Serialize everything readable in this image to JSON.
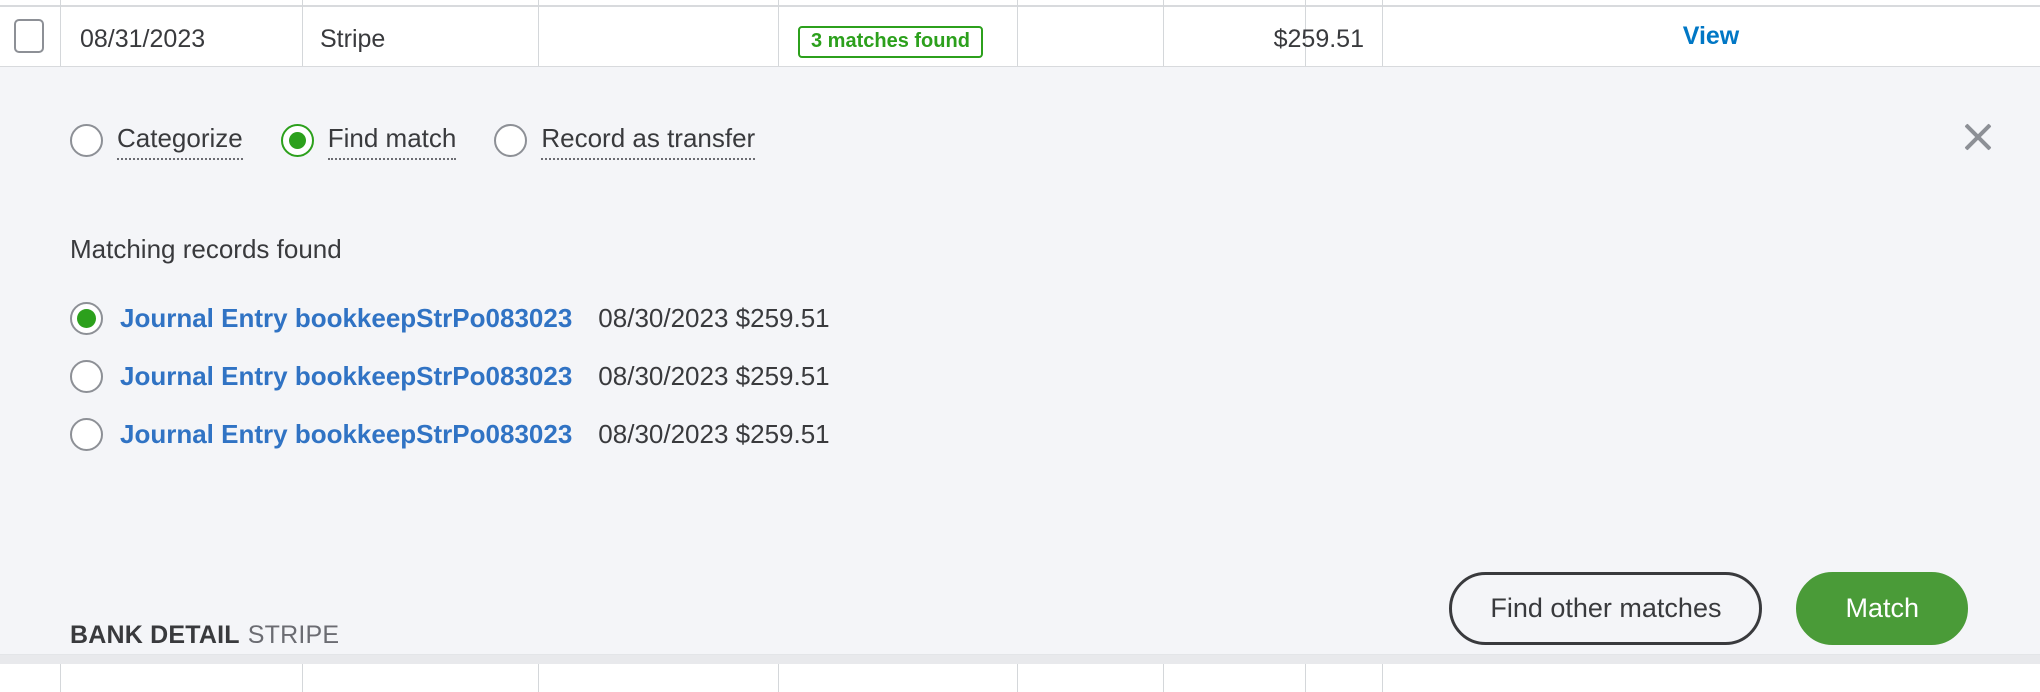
{
  "transaction_row": {
    "checkbox_checked": false,
    "date": "08/31/2023",
    "payee": "Stripe",
    "category": "",
    "badge": "3 matches found",
    "badge_color": "#2ca01c",
    "spent": "",
    "amount": "$259.51",
    "action": "View",
    "action_color": "#0077c5"
  },
  "panel": {
    "modes": [
      {
        "label": "Categorize",
        "selected": false
      },
      {
        "label": "Find match",
        "selected": true
      },
      {
        "label": "Record as transfer",
        "selected": false
      }
    ],
    "close_icon": "close-icon",
    "heading": "Matching records found",
    "records": [
      {
        "selected": true,
        "link": "Journal Entry bookkeepStrPo083023",
        "meta": "08/30/2023 $259.51"
      },
      {
        "selected": false,
        "link": "Journal Entry bookkeepStrPo083023",
        "meta": "08/30/2023 $259.51"
      },
      {
        "selected": false,
        "link": "Journal Entry bookkeepStrPo083023",
        "meta": "08/30/2023 $259.51"
      }
    ],
    "bank_detail": {
      "label": "BANK DETAIL",
      "value": "STRIPE"
    },
    "buttons": {
      "secondary": "Find other matches",
      "primary": "Match",
      "primary_color": "#4a9b38"
    }
  }
}
